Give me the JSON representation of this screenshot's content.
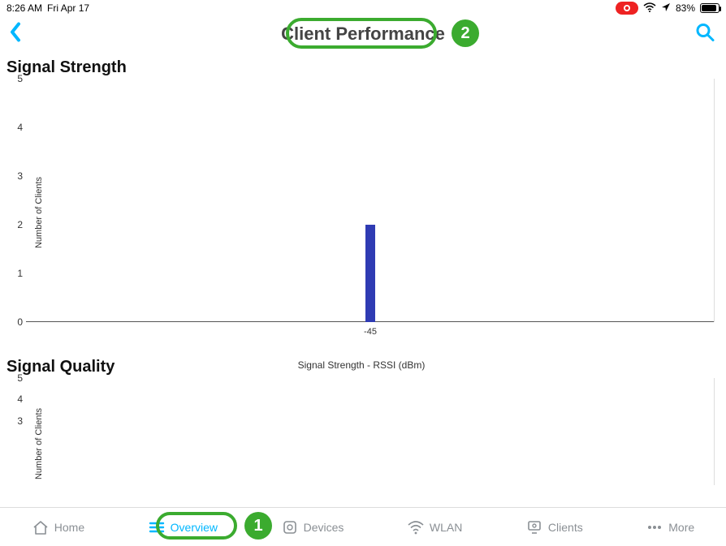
{
  "statusbar": {
    "time": "8:26 AM",
    "date": "Fri Apr 17",
    "battery_pct": "83%",
    "battery_fill": 83
  },
  "header": {
    "title": "Client Performance"
  },
  "callouts": {
    "title_badge": "2",
    "overview_badge": "1"
  },
  "sections": {
    "signal_strength_title": "Signal Strength",
    "signal_quality_title": "Signal Quality"
  },
  "chart_data": [
    {
      "id": "signal_strength",
      "type": "bar",
      "title": "Signal Strength",
      "xlabel": "Signal Strength - RSSI (dBm)",
      "ylabel": "Number of Clients",
      "ylim": [
        0,
        5
      ],
      "yticks": [
        0,
        1,
        2,
        3,
        4,
        5
      ],
      "categories": [
        "-45"
      ],
      "values": [
        2
      ]
    },
    {
      "id": "signal_quality",
      "type": "bar",
      "title": "Signal Quality",
      "xlabel": "",
      "ylabel": "Number of Clients",
      "ylim": [
        0,
        5
      ],
      "yticks": [
        3,
        4,
        5
      ],
      "categories": [],
      "values": []
    }
  ],
  "tabs": {
    "home": "Home",
    "overview": "Overview",
    "devices": "Devices",
    "wlan": "WLAN",
    "clients": "Clients",
    "more": "More"
  }
}
